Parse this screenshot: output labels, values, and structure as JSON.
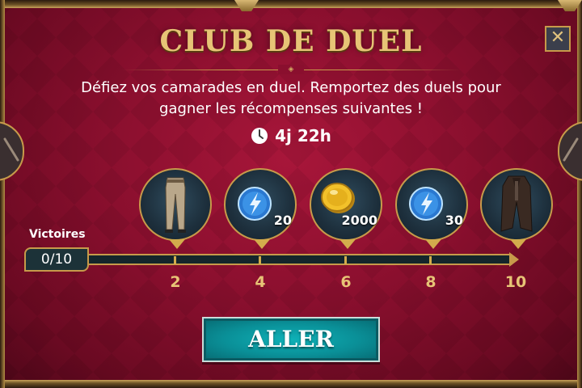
{
  "dialog": {
    "title": "CLUB DE DUEL",
    "description_line1": "Défiez vos camarades en duel. Remportez des duels pour",
    "description_line2": "gagner les récompenses suivantes !",
    "timer": "4j 22h",
    "close_label": "✕"
  },
  "rewards": [
    {
      "icon": "pants-icon",
      "quantity": ""
    },
    {
      "icon": "energy-icon",
      "quantity": "20"
    },
    {
      "icon": "gold-coin-icon",
      "quantity": "2000"
    },
    {
      "icon": "energy-icon",
      "quantity": "30"
    },
    {
      "icon": "coat-icon",
      "quantity": ""
    }
  ],
  "progress": {
    "label": "Victoires",
    "value_text": "0/10",
    "current": 0,
    "max": 10,
    "milestones": [
      "2",
      "4",
      "6",
      "8",
      "10"
    ]
  },
  "go_button": {
    "label": "ALLER"
  },
  "colors": {
    "background": "#8a0f2e",
    "gold": "#c79a4a",
    "title_gold": "#e7c476",
    "button_teal": "#0a8f97"
  }
}
